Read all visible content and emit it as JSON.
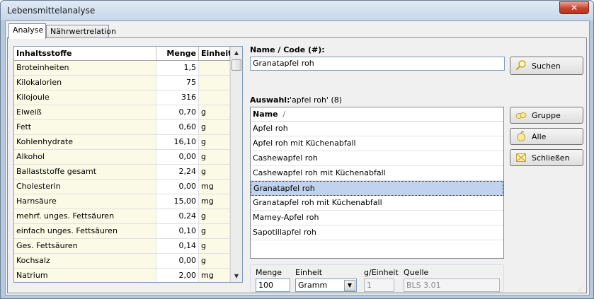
{
  "window": {
    "title": "Lebensmittelanalyse",
    "close_glyph": "✕"
  },
  "tabs": [
    {
      "label": "Analyse",
      "active": true
    },
    {
      "label": "Nährwertrelation",
      "active": false
    }
  ],
  "nutrients": {
    "headers": {
      "name": "Inhaltsstoffe",
      "amount": "Menge",
      "unit": "Einheit"
    },
    "rows": [
      {
        "name": "Broteinheiten",
        "amount": "1,5",
        "unit": ""
      },
      {
        "name": "Kilokalorien",
        "amount": "75",
        "unit": ""
      },
      {
        "name": "Kilojoule",
        "amount": "316",
        "unit": ""
      },
      {
        "name": "Eiweiß",
        "amount": "0,70",
        "unit": "g"
      },
      {
        "name": "Fett",
        "amount": "0,60",
        "unit": "g"
      },
      {
        "name": "Kohlenhydrate",
        "amount": "16,10",
        "unit": "g"
      },
      {
        "name": "Alkohol",
        "amount": "0,00",
        "unit": "g"
      },
      {
        "name": "Ballaststoffe gesamt",
        "amount": "2,24",
        "unit": "g"
      },
      {
        "name": "Cholesterin",
        "amount": "0,00",
        "unit": "mg"
      },
      {
        "name": "Harnsäure",
        "amount": "15,00",
        "unit": "mg"
      },
      {
        "name": "mehrf. unges. Fettsäuren",
        "amount": "0,24",
        "unit": "g"
      },
      {
        "name": "einfach unges. Fettsäuren",
        "amount": "0,10",
        "unit": "g"
      },
      {
        "name": "Ges. Fettsäuren",
        "amount": "0,14",
        "unit": "g"
      },
      {
        "name": "Kochsalz",
        "amount": "0,00",
        "unit": "g"
      },
      {
        "name": "Natrium",
        "amount": "2,00",
        "unit": "mg"
      }
    ]
  },
  "search": {
    "label": "Name / Code (#):",
    "value": "Granatapfel roh",
    "button": "Suchen"
  },
  "selection": {
    "label": "Auswahl:",
    "summary": "'apfel roh' (8)",
    "column_header": "Name",
    "sort_glyph": "/",
    "items": [
      "Apfel roh",
      "Apfel roh mit Küchenabfall",
      "Cashewapfel roh",
      "Cashewapfel roh mit Küchenabfall",
      "Granatapfel roh",
      "Granatapfel roh mit Küchenabfall",
      "Mamey-Apfel roh",
      "Sapotillapfel roh"
    ],
    "selected_index": 4
  },
  "buttons": {
    "group": "Gruppe",
    "all": "Alle",
    "close": "Schließen"
  },
  "portion": {
    "amount_label": "Menge",
    "amount_value": "100",
    "unit_label": "Einheit",
    "unit_value": "Gramm",
    "per_unit_label": "g/Einheit",
    "per_unit_value": "1",
    "source_label": "Quelle",
    "source_value": "BLS 3.01"
  },
  "colors": {
    "selected_row": "#c1d2ee",
    "grid_label_bg": "#fafae6"
  }
}
